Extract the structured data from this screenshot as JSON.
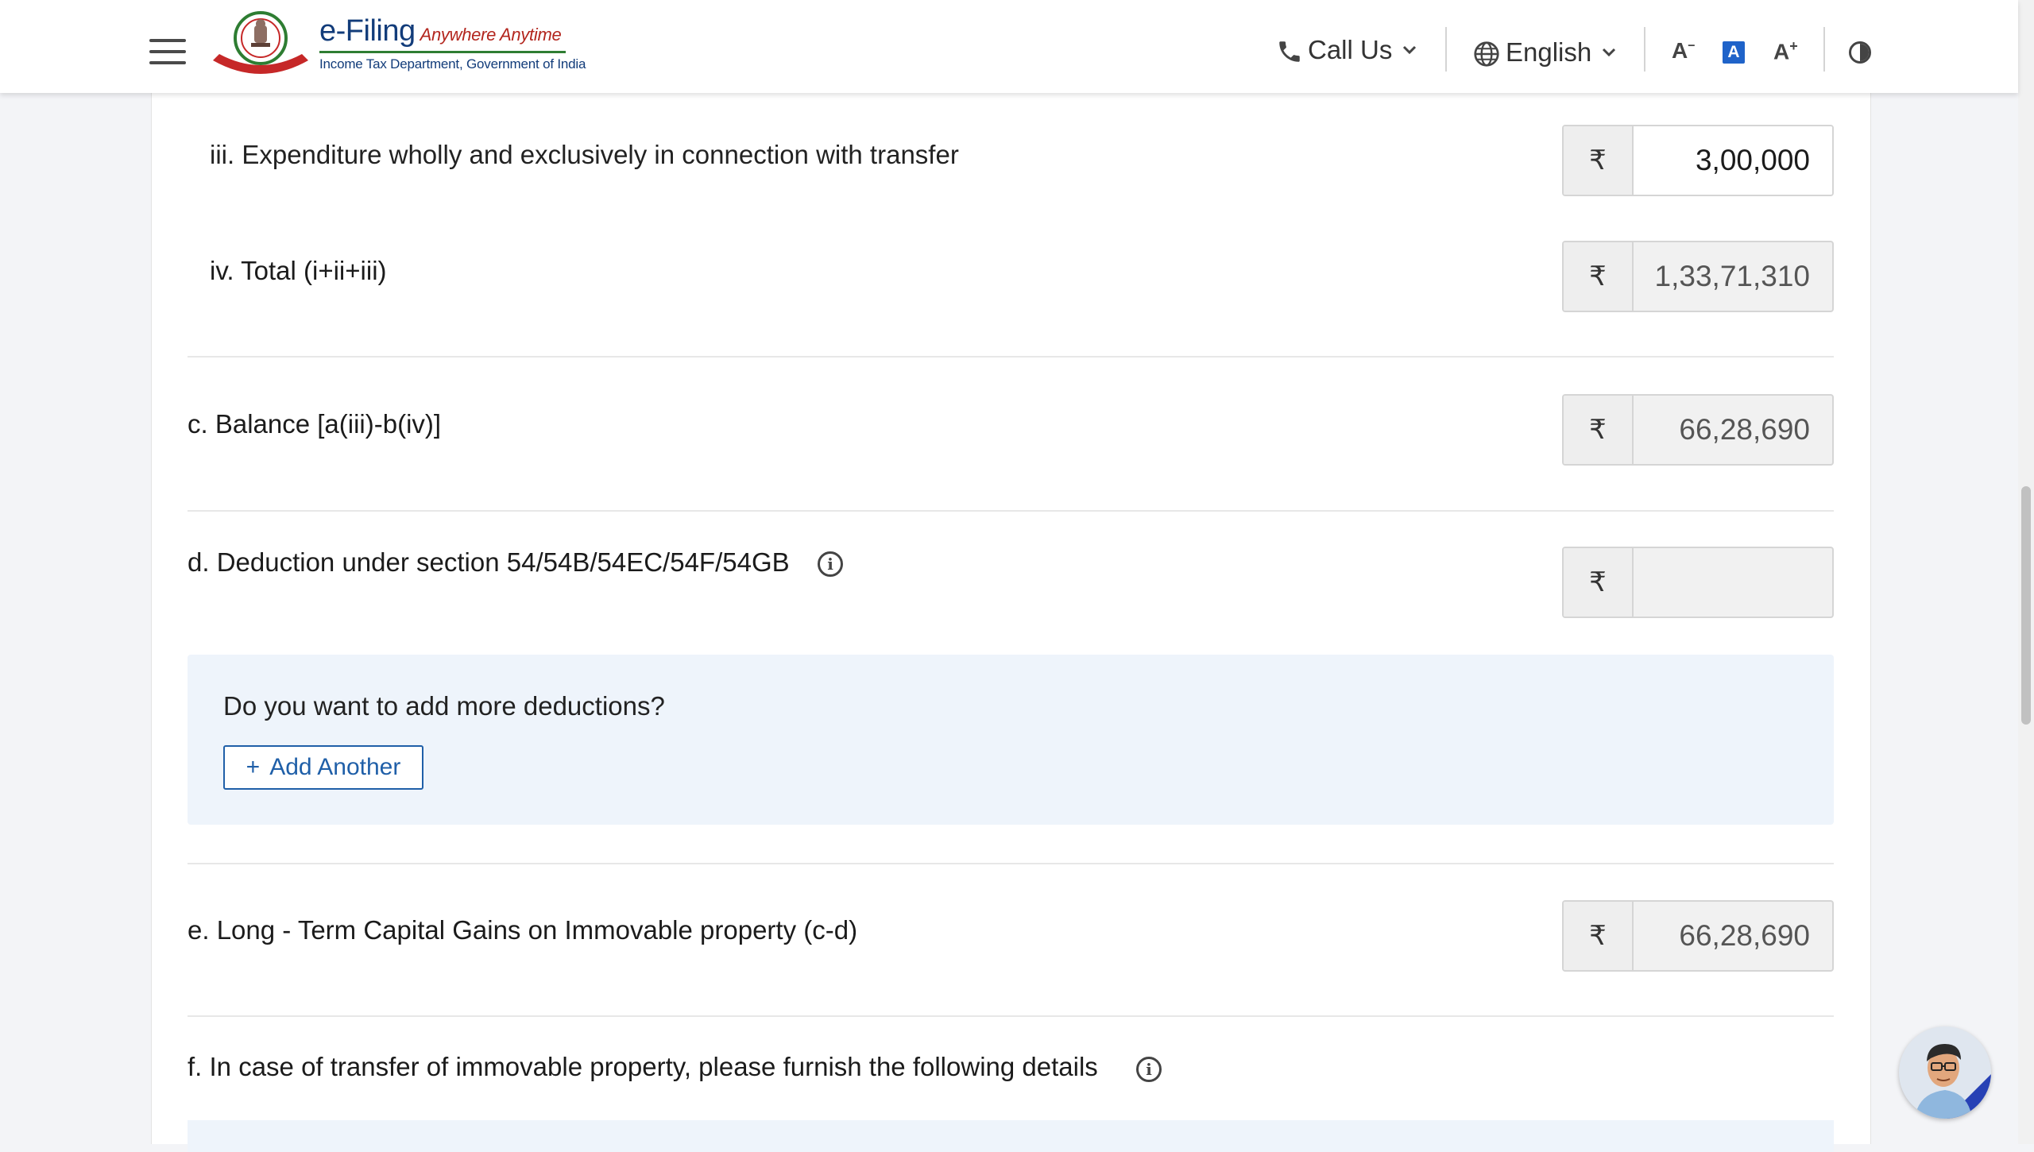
{
  "header": {
    "logo_title": "e-Filing",
    "logo_tagline": "Anywhere Anytime",
    "logo_subtitle": "Income Tax Department, Government of India",
    "call_us": "Call Us",
    "language": "English",
    "font_decrease": "A",
    "font_default": "A",
    "font_increase": "A"
  },
  "rows": {
    "b_iii": {
      "label": "iii. Expenditure wholly and exclusively in connection with transfer",
      "currency": "₹",
      "value": "3,00,000"
    },
    "b_iv": {
      "label": "iv. Total (i+ii+iii)",
      "currency": "₹",
      "value": "1,33,71,310"
    },
    "c": {
      "label": "c. Balance [a(iii)-b(iv)]",
      "currency": "₹",
      "value": "66,28,690"
    },
    "d": {
      "label": "d. Deduction under section 54/54B/54EC/54F/54GB",
      "currency": "₹",
      "value": ""
    },
    "e": {
      "label": "e. Long - Term Capital Gains on Immovable property (c-d)",
      "currency": "₹",
      "value": "66,28,690"
    },
    "f": {
      "label": "f. In case of transfer of immovable property, please furnish the following details"
    }
  },
  "deduction_panel": {
    "question": "Do you want to add more deductions?",
    "add_button": "Add Another",
    "add_symbol": "+"
  },
  "icons": [
    "hamburger-menu-icon",
    "emblem-logo",
    "phone-icon",
    "chevron-down-icon",
    "globe-icon",
    "info-icon",
    "contrast-icon",
    "chatbot-avatar"
  ],
  "colors": {
    "brand_blue": "#123c7a",
    "link_blue": "#1f5fa8",
    "panel_bg": "#eef4fb",
    "accent_font_btn": "#1f63c9"
  }
}
